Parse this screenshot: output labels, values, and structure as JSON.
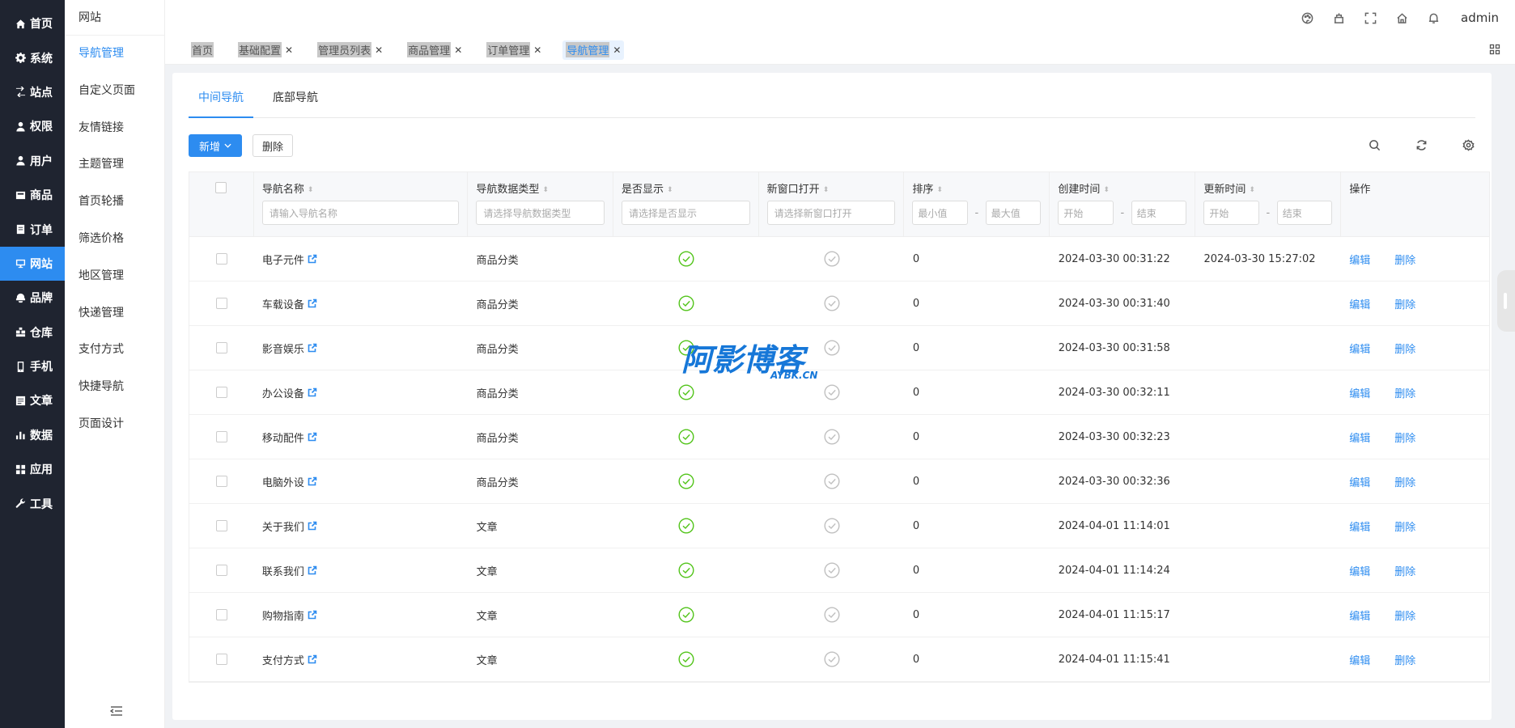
{
  "sidebar": {
    "items": [
      {
        "label": "首页",
        "icon": "home-icon"
      },
      {
        "label": "系统",
        "icon": "gear-icon"
      },
      {
        "label": "站点",
        "icon": "site-icon"
      },
      {
        "label": "权限",
        "icon": "permission-icon"
      },
      {
        "label": "用户",
        "icon": "user-icon"
      },
      {
        "label": "商品",
        "icon": "goods-icon"
      },
      {
        "label": "订单",
        "icon": "order-icon"
      },
      {
        "label": "网站",
        "icon": "website-icon",
        "active": true
      },
      {
        "label": "品牌",
        "icon": "brand-icon"
      },
      {
        "label": "仓库",
        "icon": "warehouse-icon"
      },
      {
        "label": "手机",
        "icon": "phone-icon"
      },
      {
        "label": "文章",
        "icon": "article-icon"
      },
      {
        "label": "数据",
        "icon": "chart-icon"
      },
      {
        "label": "应用",
        "icon": "apps-icon"
      },
      {
        "label": "工具",
        "icon": "wrench-icon"
      }
    ],
    "accent": "#2d8cf0"
  },
  "submenu": {
    "title": "网站",
    "items": [
      {
        "label": "导航管理",
        "active": true
      },
      {
        "label": "自定义页面"
      },
      {
        "label": "友情链接"
      },
      {
        "label": "主题管理"
      },
      {
        "label": "首页轮播"
      },
      {
        "label": "筛选价格"
      },
      {
        "label": "地区管理"
      },
      {
        "label": "快递管理"
      },
      {
        "label": "支付方式"
      },
      {
        "label": "快捷导航"
      },
      {
        "label": "页面设计"
      }
    ]
  },
  "header": {
    "icons": [
      "palette-icon",
      "clear-cache-icon",
      "fullscreen-icon",
      "home-icon",
      "bell-icon"
    ],
    "user": "admin"
  },
  "tabs": [
    {
      "label": "首页",
      "closable": false
    },
    {
      "label": "基础配置",
      "closable": true
    },
    {
      "label": "管理员列表",
      "closable": true
    },
    {
      "label": "商品管理",
      "closable": true
    },
    {
      "label": "订单管理",
      "closable": true
    },
    {
      "label": "导航管理",
      "closable": true,
      "active": true
    }
  ],
  "content_tabs": [
    {
      "label": "中间导航",
      "active": true
    },
    {
      "label": "底部导航"
    }
  ],
  "toolbar": {
    "add_label": "新增",
    "delete_label": "删除"
  },
  "table": {
    "columns": {
      "name": {
        "label": "导航名称",
        "placeholder": "请输入导航名称"
      },
      "data_type": {
        "label": "导航数据类型",
        "placeholder": "请选择导航数据类型"
      },
      "show": {
        "label": "是否显示",
        "placeholder": "请选择是否显示"
      },
      "new_window": {
        "label": "新窗口打开",
        "placeholder": "请选择新窗口打开"
      },
      "sort": {
        "label": "排序",
        "min": "最小值",
        "max": "最大值"
      },
      "created": {
        "label": "创建时间",
        "start": "开始",
        "end": "结束"
      },
      "updated": {
        "label": "更新时间",
        "start": "开始",
        "end": "结束"
      },
      "actions": {
        "label": "操作"
      }
    },
    "range_separator": "-",
    "edit_label": "编辑",
    "delete_label": "删除",
    "rows": [
      {
        "name": "电子元件",
        "type": "商品分类",
        "show": true,
        "new_window": false,
        "sort": "0",
        "created": "2024-03-30 00:31:22",
        "updated": "2024-03-30 15:27:02"
      },
      {
        "name": "车载设备",
        "type": "商品分类",
        "show": true,
        "new_window": false,
        "sort": "0",
        "created": "2024-03-30 00:31:40",
        "updated": ""
      },
      {
        "name": "影音娱乐",
        "type": "商品分类",
        "show": true,
        "new_window": false,
        "sort": "0",
        "created": "2024-03-30 00:31:58",
        "updated": ""
      },
      {
        "name": "办公设备",
        "type": "商品分类",
        "show": true,
        "new_window": false,
        "sort": "0",
        "created": "2024-03-30 00:32:11",
        "updated": ""
      },
      {
        "name": "移动配件",
        "type": "商品分类",
        "show": true,
        "new_window": false,
        "sort": "0",
        "created": "2024-03-30 00:32:23",
        "updated": ""
      },
      {
        "name": "电脑外设",
        "type": "商品分类",
        "show": true,
        "new_window": false,
        "sort": "0",
        "created": "2024-03-30 00:32:36",
        "updated": ""
      },
      {
        "name": "关于我们",
        "type": "文章",
        "show": true,
        "new_window": false,
        "sort": "0",
        "created": "2024-04-01 11:14:01",
        "updated": ""
      },
      {
        "name": "联系我们",
        "type": "文章",
        "show": true,
        "new_window": false,
        "sort": "0",
        "created": "2024-04-01 11:14:24",
        "updated": ""
      },
      {
        "name": "购物指南",
        "type": "文章",
        "show": true,
        "new_window": false,
        "sort": "0",
        "created": "2024-04-01 11:15:17",
        "updated": ""
      },
      {
        "name": "支付方式",
        "type": "文章",
        "show": true,
        "new_window": false,
        "sort": "0",
        "created": "2024-04-01 11:15:41",
        "updated": ""
      }
    ]
  },
  "watermark": {
    "main": "阿影博客",
    "sub": "AYBK.CN"
  },
  "colors": {
    "primary": "#2d8cf0",
    "success": "#52c41a",
    "muted": "#c0c0c0",
    "sidebar_bg": "#1f2430"
  }
}
